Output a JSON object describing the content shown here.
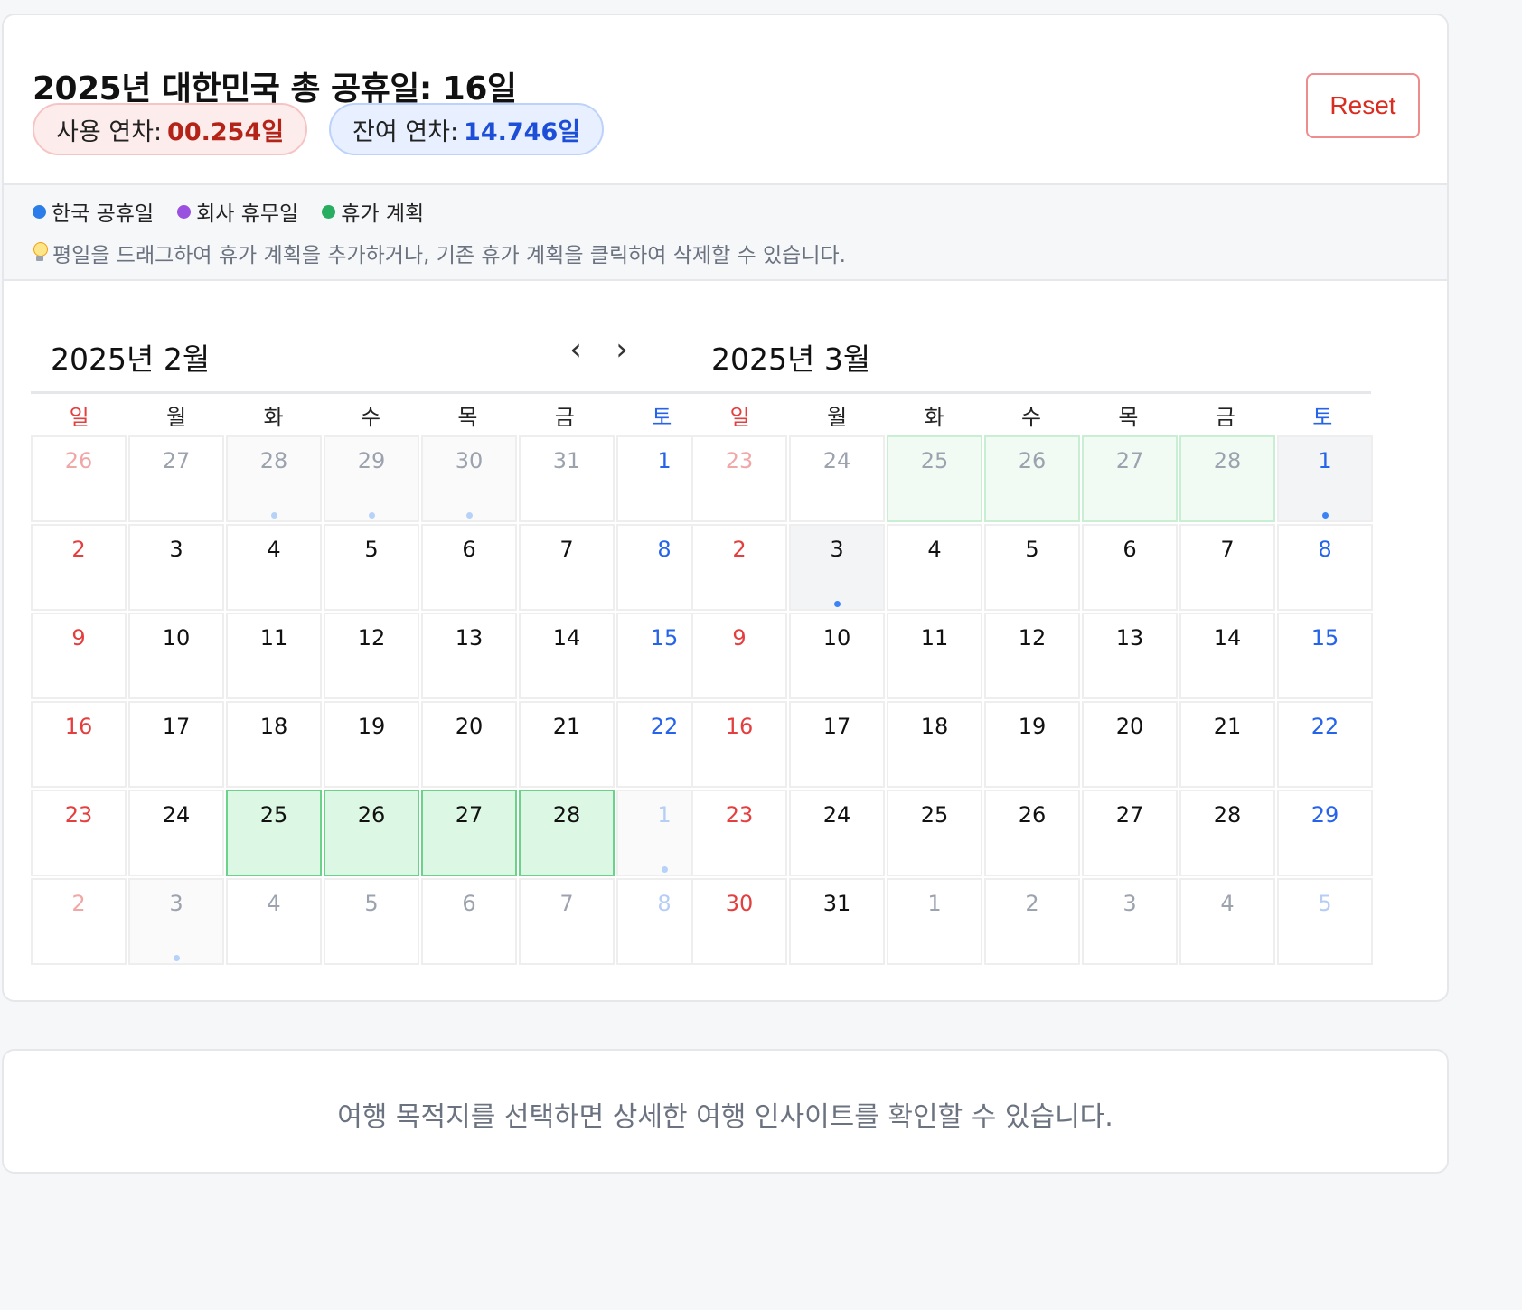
{
  "header": {
    "title": "2025년 대한민국 총 공휴일: 16일",
    "used_label": "사용 연차:",
    "used_value": "00.254일",
    "remain_label": "잔여 연차:",
    "remain_value": "14.746일",
    "reset_label": "Reset"
  },
  "legend": {
    "items": [
      {
        "label": "한국 공휴일",
        "color": "#2b7de9"
      },
      {
        "label": "회사 휴무일",
        "color": "#9b51e0"
      },
      {
        "label": "휴가 계획",
        "color": "#27ae60"
      }
    ],
    "tip": "평일을 드래그하여 휴가 계획을 추가하거나, 기존 휴가 계획을 클릭하여 삭제할 수 있습니다."
  },
  "weekdays": [
    "일",
    "월",
    "화",
    "수",
    "목",
    "금",
    "토"
  ],
  "nav": {
    "prev_icon": "chevron-left-icon",
    "next_icon": "chevron-right-icon"
  },
  "calendars": [
    {
      "title": "2025년 2월",
      "days": [
        {
          "n": "26",
          "out": true
        },
        {
          "n": "27",
          "out": true
        },
        {
          "n": "28",
          "out": true,
          "holiday": true
        },
        {
          "n": "29",
          "out": true,
          "holiday": true
        },
        {
          "n": "30",
          "out": true,
          "holiday": true
        },
        {
          "n": "31",
          "out": true
        },
        {
          "n": "1"
        },
        {
          "n": "2"
        },
        {
          "n": "3"
        },
        {
          "n": "4"
        },
        {
          "n": "5"
        },
        {
          "n": "6"
        },
        {
          "n": "7"
        },
        {
          "n": "8"
        },
        {
          "n": "9"
        },
        {
          "n": "10"
        },
        {
          "n": "11"
        },
        {
          "n": "12"
        },
        {
          "n": "13"
        },
        {
          "n": "14"
        },
        {
          "n": "15"
        },
        {
          "n": "16"
        },
        {
          "n": "17"
        },
        {
          "n": "18"
        },
        {
          "n": "19"
        },
        {
          "n": "20"
        },
        {
          "n": "21"
        },
        {
          "n": "22"
        },
        {
          "n": "23"
        },
        {
          "n": "24"
        },
        {
          "n": "25",
          "vacation": true
        },
        {
          "n": "26",
          "vacation": true
        },
        {
          "n": "27",
          "vacation": true
        },
        {
          "n": "28",
          "vacation": true
        },
        {
          "n": "1",
          "out": true,
          "holiday": true
        },
        {
          "n": "2",
          "out": true
        },
        {
          "n": "3",
          "out": true,
          "holiday": true
        },
        {
          "n": "4",
          "out": true
        },
        {
          "n": "5",
          "out": true
        },
        {
          "n": "6",
          "out": true
        },
        {
          "n": "7",
          "out": true
        },
        {
          "n": "8",
          "out": true
        }
      ]
    },
    {
      "title": "2025년 3월",
      "days": [
        {
          "n": "23",
          "out": true
        },
        {
          "n": "24",
          "out": true
        },
        {
          "n": "25",
          "out": true,
          "vacation": true
        },
        {
          "n": "26",
          "out": true,
          "vacation": true
        },
        {
          "n": "27",
          "out": true,
          "vacation": true
        },
        {
          "n": "28",
          "out": true,
          "vacation": true
        },
        {
          "n": "1",
          "holiday": true
        },
        {
          "n": "2"
        },
        {
          "n": "3",
          "holiday": true
        },
        {
          "n": "4"
        },
        {
          "n": "5"
        },
        {
          "n": "6"
        },
        {
          "n": "7"
        },
        {
          "n": "8"
        },
        {
          "n": "9"
        },
        {
          "n": "10"
        },
        {
          "n": "11"
        },
        {
          "n": "12"
        },
        {
          "n": "13"
        },
        {
          "n": "14"
        },
        {
          "n": "15"
        },
        {
          "n": "16"
        },
        {
          "n": "17"
        },
        {
          "n": "18"
        },
        {
          "n": "19"
        },
        {
          "n": "20"
        },
        {
          "n": "21"
        },
        {
          "n": "22"
        },
        {
          "n": "23"
        },
        {
          "n": "24"
        },
        {
          "n": "25"
        },
        {
          "n": "26"
        },
        {
          "n": "27"
        },
        {
          "n": "28"
        },
        {
          "n": "29"
        },
        {
          "n": "30"
        },
        {
          "n": "31"
        },
        {
          "n": "1",
          "out": true
        },
        {
          "n": "2",
          "out": true
        },
        {
          "n": "3",
          "out": true
        },
        {
          "n": "4",
          "out": true
        },
        {
          "n": "5",
          "out": true
        }
      ]
    }
  ],
  "insight": {
    "message": "여행 목적지를 선택하면 상세한 여행 인사이트를 확인할 수 있습니다."
  }
}
